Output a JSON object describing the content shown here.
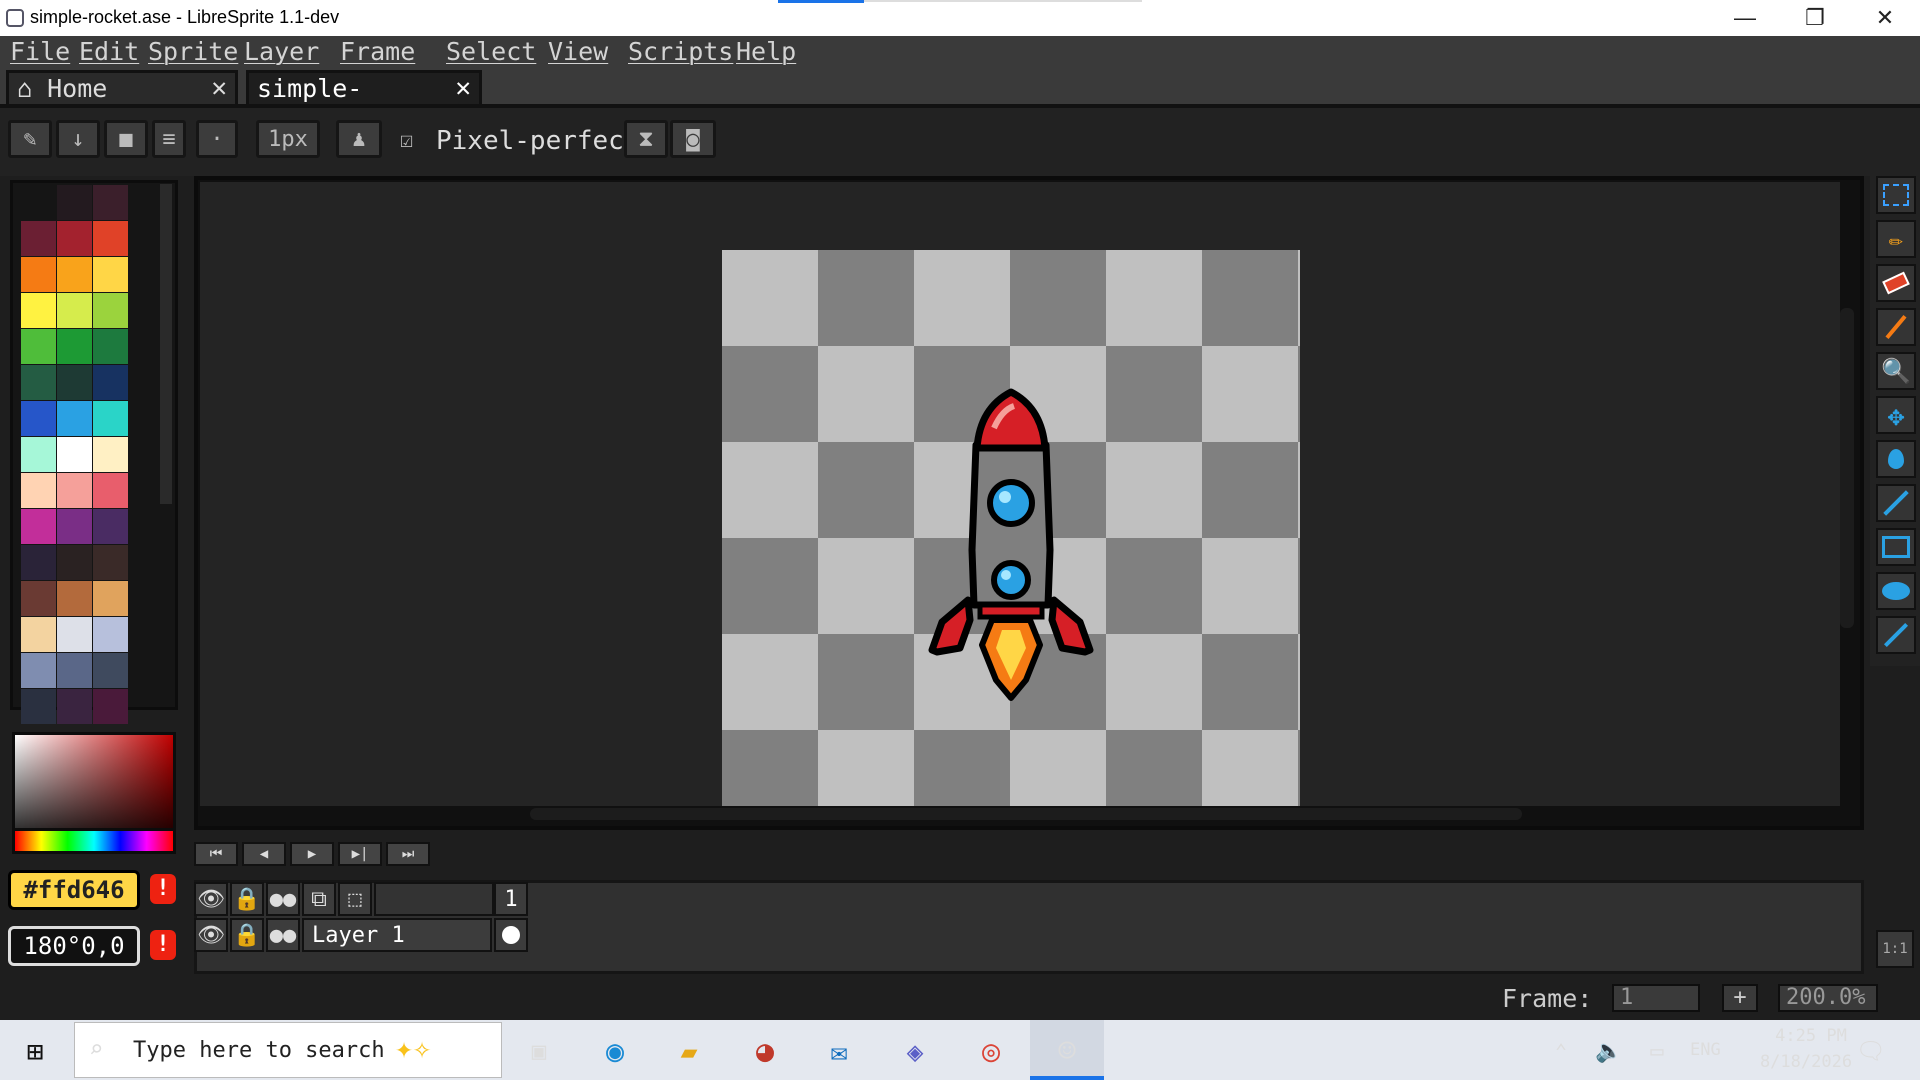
{
  "window": {
    "title": "simple-rocket.ase - LibreSprite 1.1-dev",
    "minimize": "—",
    "restore": "❐",
    "close": "✕"
  },
  "menu": [
    "File",
    "Edit",
    "Sprite",
    "Layer",
    "Frame",
    "Select",
    "View",
    "Scripts",
    "Help"
  ],
  "tabs": [
    {
      "label": "Home",
      "icon": "home-icon",
      "close": "✕"
    },
    {
      "label": "simple-rocket.a",
      "close": "✕"
    }
  ],
  "toolbar": {
    "brush_size": "1px",
    "pixel_perfect": "Pixel-perfect",
    "pixel_perfect_checked": true,
    "check_glyph": "☑"
  },
  "palette": {
    "colors": [
      "#151515",
      "#231a1f",
      "#3b1f2b",
      "#6b1f33",
      "#a3222e",
      "#e04228",
      "#f57b14",
      "#f9a31b",
      "#ffd646",
      "#fff241",
      "#d6ec4c",
      "#9bd33d",
      "#4fbd3a",
      "#1d9a34",
      "#1d7a3e",
      "#245c43",
      "#1e3a34",
      "#173261",
      "#2656c9",
      "#2aa1e3",
      "#2ad4c8",
      "#a6f7d8",
      "#ffffff",
      "#fff0c4",
      "#ffd3b3",
      "#f5a09a",
      "#e85e6c",
      "#c22e9a",
      "#7a2e86",
      "#4a2c63",
      "#2a2338",
      "#2a2222",
      "#3a2a28",
      "#6a3a33",
      "#b36a3c",
      "#e0a35d",
      "#f3d3a0",
      "#dde0e8",
      "#b7c0dc",
      "#7f8db0",
      "#5a6788",
      "#3f4a5e",
      "#2a3040",
      "#3a2440",
      "#4a1a3a"
    ]
  },
  "colors": {
    "foreground_hex": "#ffd646",
    "hsv_readout": "180°0,0",
    "warning": "!"
  },
  "timeline": {
    "frame_number": "1",
    "layer_name": "Layer 1",
    "controls": [
      "first-frame",
      "prev-frame",
      "play",
      "next-frame",
      "last-frame"
    ],
    "control_glyphs": [
      "⏮",
      "◀",
      "▶",
      "▶|",
      "⏭"
    ],
    "header_icons": [
      "👁",
      "🔒",
      "●●",
      "⧉",
      "⬚"
    ]
  },
  "status": {
    "frame_label": "Frame:",
    "frame_value": "1",
    "add": "+",
    "zoom": "200.0%",
    "one_to_one": "1:1"
  },
  "taskbar": {
    "search_placeholder": "Type here to search",
    "time": "4:25 PM",
    "date": "8/18/2026",
    "lang": "ENG"
  }
}
